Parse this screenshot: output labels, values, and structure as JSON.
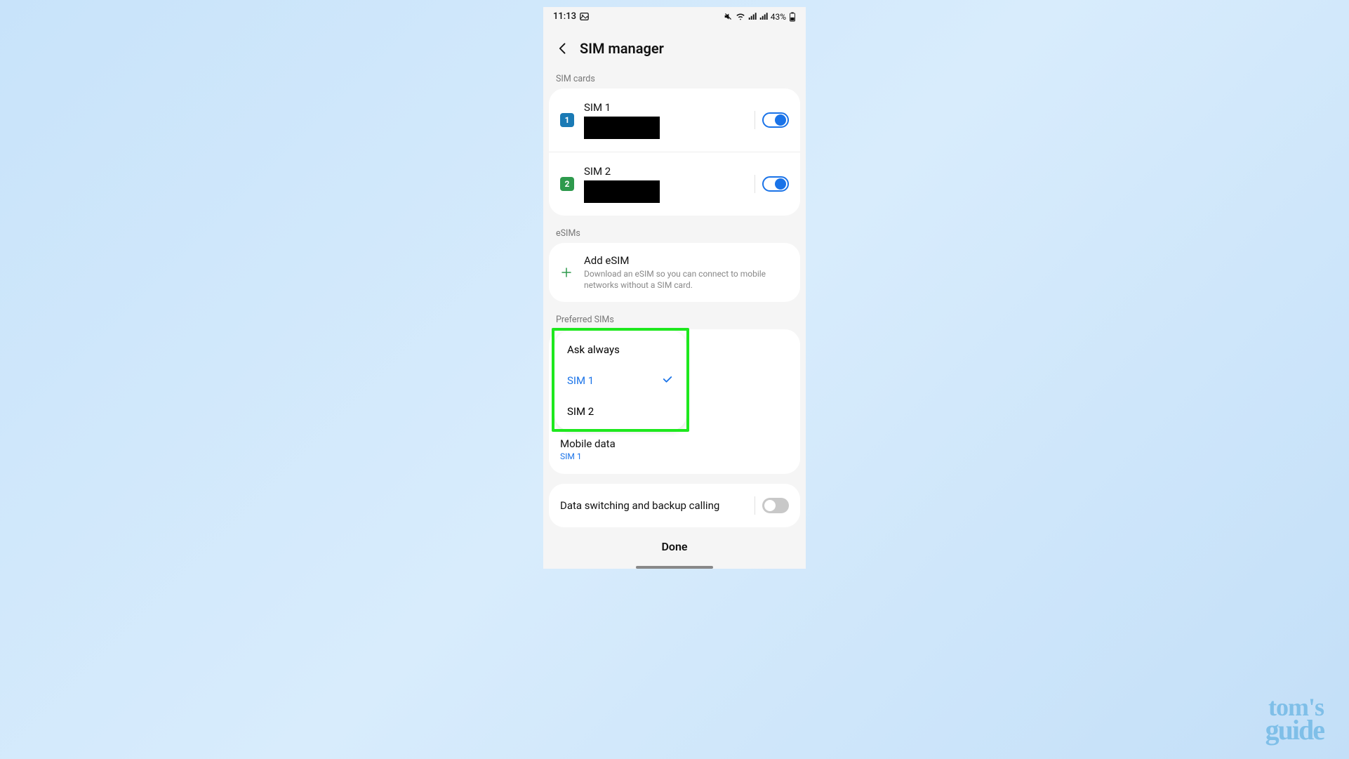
{
  "status": {
    "time": "11:13",
    "battery_pct": "43%"
  },
  "header": {
    "title": "SIM manager"
  },
  "sections": {
    "sim_cards_label": "SIM cards",
    "esims_label": "eSIMs",
    "preferred_label": "Preferred SIMs"
  },
  "sims": [
    {
      "badge": "1",
      "name": "SIM 1",
      "enabled": true
    },
    {
      "badge": "2",
      "name": "SIM 2",
      "enabled": true
    }
  ],
  "esim": {
    "title": "Add eSIM",
    "description": "Download an eSIM so you can connect to mobile networks without a SIM card."
  },
  "dropdown": {
    "options": [
      {
        "label": "Ask always",
        "selected": false
      },
      {
        "label": "SIM 1",
        "selected": true
      },
      {
        "label": "SIM 2",
        "selected": false
      }
    ]
  },
  "preferred": {
    "mobile_data": {
      "title": "Mobile data",
      "value": "SIM 1"
    }
  },
  "data_switching": {
    "title": "Data switching and backup calling",
    "enabled": false
  },
  "done_label": "Done",
  "logo": {
    "top": "tom's",
    "bottom": "guide"
  }
}
